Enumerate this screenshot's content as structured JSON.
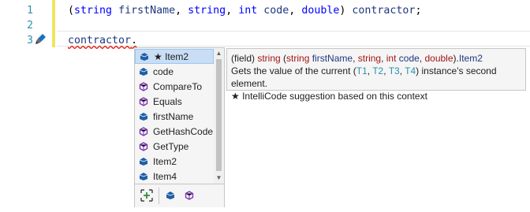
{
  "editor": {
    "line_numbers": [
      "1",
      "2",
      "3"
    ],
    "line1": {
      "open_paren": "(",
      "t1": "string",
      "n1": "firstName",
      "comma1": ", ",
      "t2": "string",
      "comma2": ", ",
      "t3": "int",
      "n3": "code",
      "comma3": ", ",
      "t4": "double",
      "close": ") ",
      "var": "contractor",
      "semi": ";"
    },
    "line3": {
      "var": "contractor",
      "dot": "."
    },
    "colors": {
      "keyword": "#0000ff",
      "identifier": "#1f377f",
      "line_number": "#2b91af",
      "change_bar": "#f1e35f"
    }
  },
  "completion": {
    "items": [
      {
        "label": "★ Item2",
        "icon": "field-icon",
        "selected": true
      },
      {
        "label": "code",
        "icon": "field-icon"
      },
      {
        "label": "CompareTo",
        "icon": "method-icon"
      },
      {
        "label": "Equals",
        "icon": "method-icon"
      },
      {
        "label": "firstName",
        "icon": "field-icon"
      },
      {
        "label": "GetHashCode",
        "icon": "method-icon"
      },
      {
        "label": "GetType",
        "icon": "method-icon"
      },
      {
        "label": "Item2",
        "icon": "field-icon"
      },
      {
        "label": "Item4",
        "icon": "field-icon"
      }
    ],
    "filters": [
      "expand-icon",
      "field-filter-icon",
      "method-filter-icon"
    ]
  },
  "tooltip": {
    "line1": {
      "prefix": "(field) ",
      "t1": "string",
      "sp": " (",
      "t2": "string",
      "n2": " firstName",
      "c1": ", ",
      "t3": "string",
      "c2": ", ",
      "t4": "int",
      "n4": " code",
      "c3": ", ",
      "t5": "double",
      "suffix": ").",
      "member": "Item2"
    },
    "line2": {
      "a": "Gets the value of the current (",
      "T1": "T1",
      "s1": ", ",
      "T2": "T2",
      "s2": ", ",
      "T3": "T3",
      "s3": ", ",
      "T4": "T4",
      "b": ") instance's second element."
    },
    "line3": "★  IntelliCode suggestion based on this context"
  }
}
